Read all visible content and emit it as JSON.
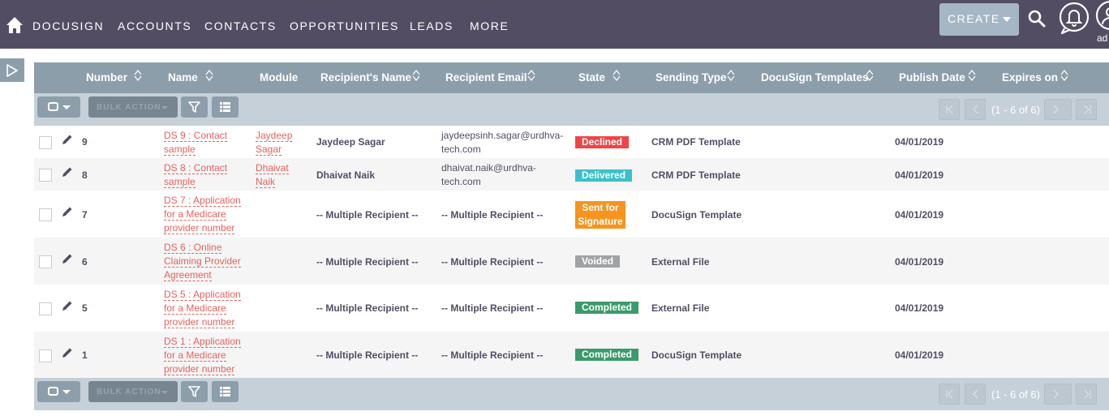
{
  "nav": {
    "items": [
      "DOCUSIGN",
      "ACCOUNTS",
      "CONTACTS",
      "OPPORTUNITIES",
      "LEADS",
      "MORE"
    ],
    "create_label": "CREATE",
    "user_label": "ad"
  },
  "table": {
    "columns": [
      "Number",
      "Name",
      "Module",
      "Recipient's Name",
      "Recipient Email",
      "State",
      "Sending Type",
      "DocuSign Templates",
      "Publish Date",
      "Expires on"
    ],
    "rows": [
      {
        "number": "9",
        "name": "DS 9 : Contact sample",
        "module": "Jaydeep Sagar",
        "recipient_name": "Jaydeep Sagar",
        "recipient_email": "jaydeepsinh.sagar@urdhva-tech.com",
        "state": "Declined",
        "state_color": "#f04545",
        "sending_type": "CRM PDF Template",
        "docusign_templates": "",
        "publish_date": "04/01/2019",
        "expires_on": ""
      },
      {
        "number": "8",
        "name": "DS 8 : Contact sample",
        "module": "Dhaivat Naik",
        "recipient_name": "Dhaivat Naik",
        "recipient_email": "dhaivat.naik@urdhva-tech.com",
        "state": "Delivered",
        "state_color": "#3ac1c8",
        "sending_type": "CRM PDF Template",
        "docusign_templates": "",
        "publish_date": "04/01/2019",
        "expires_on": ""
      },
      {
        "number": "7",
        "name": "DS 7 : Application for a Medicare provider number",
        "module": "",
        "recipient_name": "-- Multiple Recipient --",
        "recipient_email": "-- Multiple Recipient --",
        "state": "Sent for Signature",
        "state_color": "#f7941d",
        "sending_type": "DocuSign Template",
        "docusign_templates": "",
        "publish_date": "04/01/2019",
        "expires_on": ""
      },
      {
        "number": "6",
        "name": "DS 6 : Online Claiming Provider Agreement",
        "module": "",
        "recipient_name": "-- Multiple Recipient --",
        "recipient_email": "-- Multiple Recipient --",
        "state": "Voided",
        "state_color": "#9fa3a6",
        "sending_type": "External File",
        "docusign_templates": "",
        "publish_date": "04/01/2019",
        "expires_on": ""
      },
      {
        "number": "5",
        "name": "DS 5 : Application for a Medicare provider number",
        "module": "",
        "recipient_name": "-- Multiple Recipient --",
        "recipient_email": "-- Multiple Recipient --",
        "state": "Completed",
        "state_color": "#3a9a6b",
        "sending_type": "External File",
        "docusign_templates": "",
        "publish_date": "04/01/2019",
        "expires_on": ""
      },
      {
        "number": "1",
        "name": "DS 1 : Application for a Medicare provider number",
        "module": "",
        "recipient_name": "-- Multiple Recipient --",
        "recipient_email": "-- Multiple Recipient --",
        "state": "Completed",
        "state_color": "#3a9a6b",
        "sending_type": "DocuSign Template",
        "docusign_templates": "",
        "publish_date": "04/01/2019",
        "expires_on": ""
      }
    ]
  },
  "pagination": {
    "bulk_action_label": "BULK ACTION",
    "count": "(1 - 6 of 6)"
  }
}
